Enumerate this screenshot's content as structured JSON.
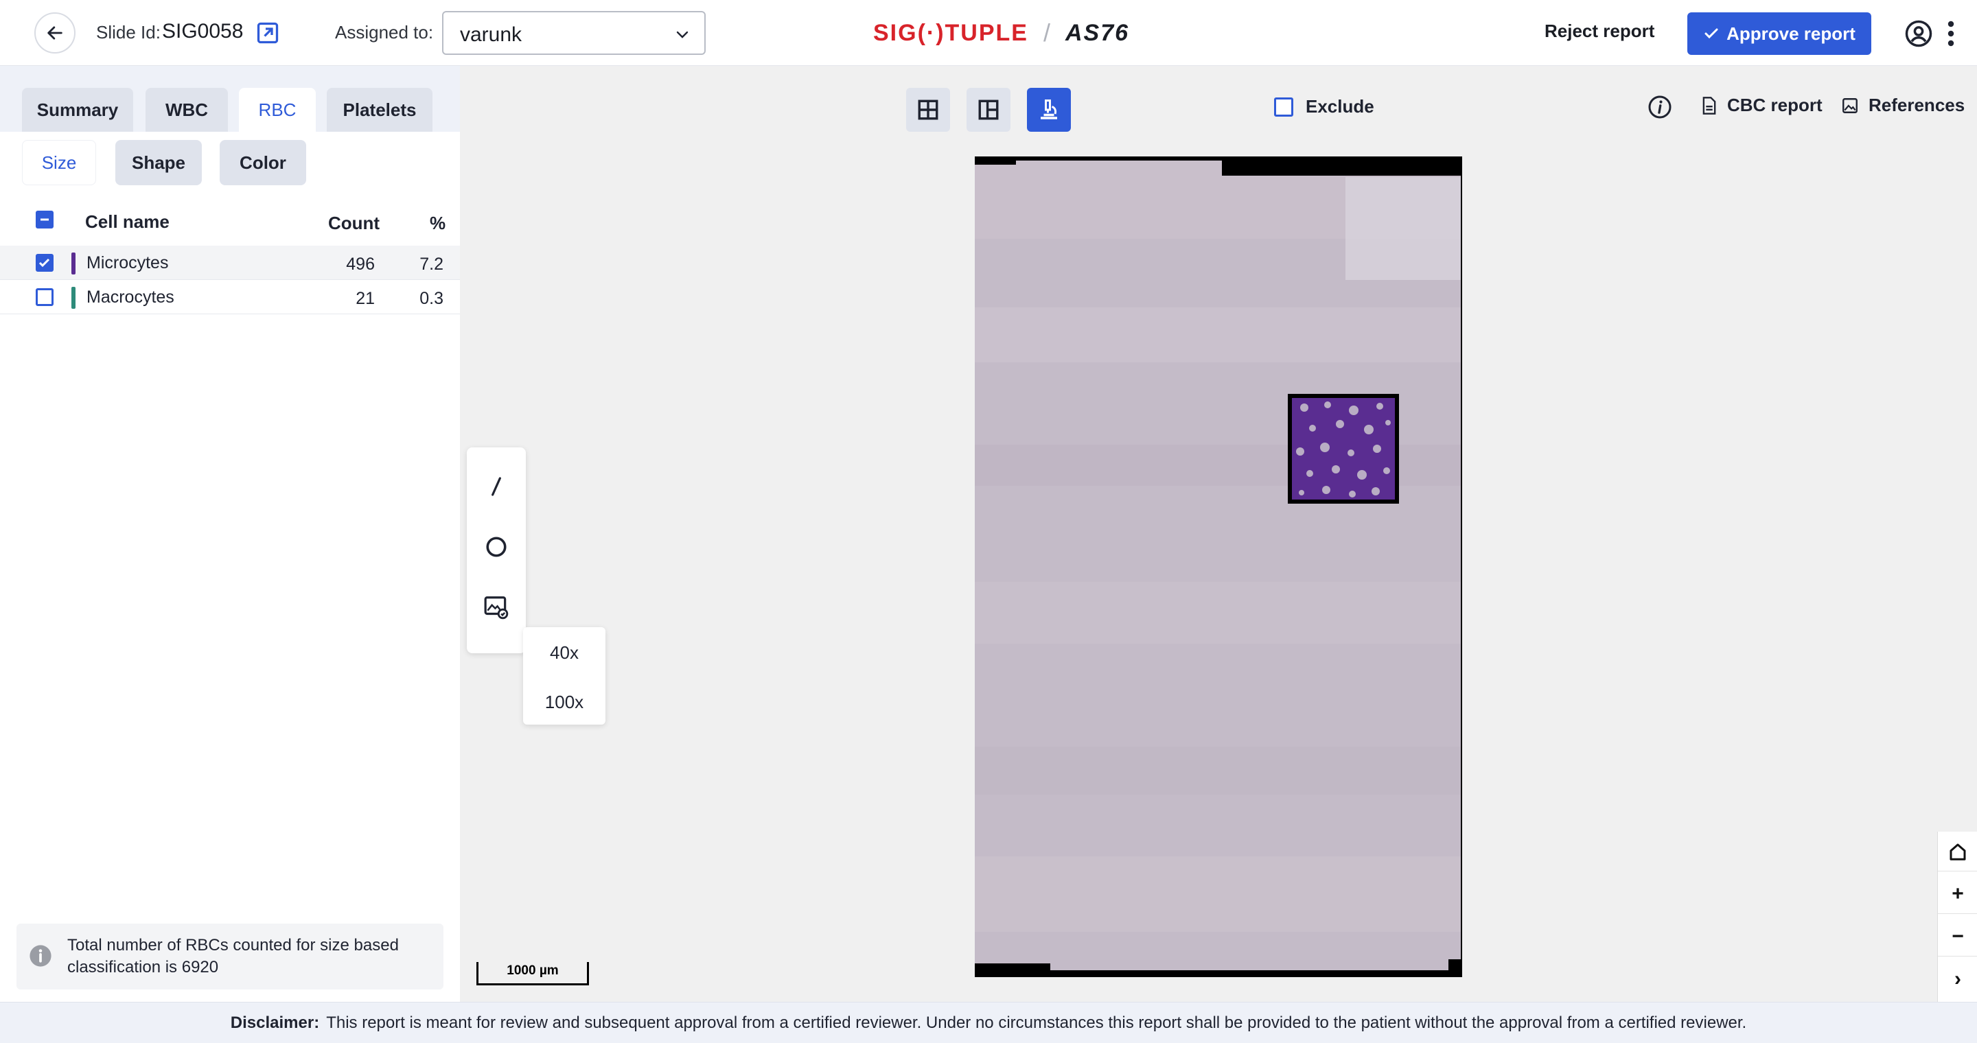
{
  "header": {
    "slide_label": "Slide Id:",
    "slide_id": "SIG0058",
    "assigned_label": "Assigned to:",
    "assigned_value": "varunk",
    "logo_brand": "SIG(·)TUPLE",
    "logo_separator": "/",
    "logo_model": "AS76",
    "reject_label": "Reject report",
    "approve_label": "Approve report"
  },
  "tabs": [
    "Summary",
    "WBC",
    "RBC",
    "Platelets"
  ],
  "active_tab": "RBC",
  "subtabs": [
    "Size",
    "Shape",
    "Color"
  ],
  "active_subtab": "Size",
  "table": {
    "headers": {
      "name": "Cell name",
      "count": "Count",
      "percent": "%"
    },
    "rows": [
      {
        "name": "Microcytes",
        "count": "496",
        "percent": "7.2",
        "checked": true,
        "color": "#5a2d91"
      },
      {
        "name": "Macrocytes",
        "count": "21",
        "percent": "0.3",
        "checked": false,
        "color": "#2e8b7a"
      }
    ]
  },
  "info_text": "Total number of RBCs counted for size based classification is 6920",
  "viewer": {
    "exclude_label": "Exclude",
    "cbc_label": "CBC report",
    "references_label": "References",
    "zoom_options": [
      "40x",
      "100x"
    ],
    "scale_label": "1000 µm",
    "nav": {
      "home": "⌂",
      "zoom_in": "+",
      "zoom_out": "−",
      "expand": "›"
    }
  },
  "footer": {
    "title": "Disclaimer:",
    "text": "This report is meant for review and subsequent approval from a certified reviewer. Under no circumstances this report shall be provided to the patient without the approval from a certified reviewer."
  },
  "colors": {
    "accent": "#2f5bd8",
    "brand": "#d8232a",
    "microcytes": "#5a2d91",
    "macrocytes": "#2e8b7a"
  }
}
